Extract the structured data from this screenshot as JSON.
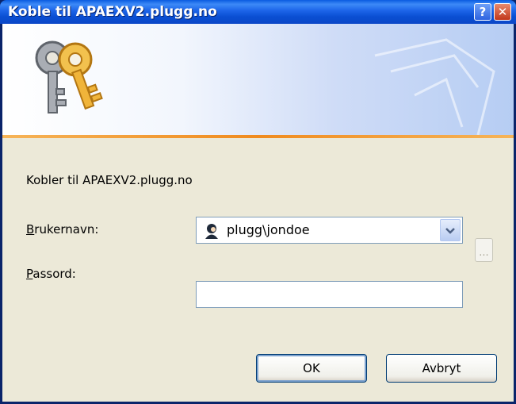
{
  "window": {
    "title": "Koble til APAEXV2.plugg.no"
  },
  "titlebar": {
    "help_label": "?",
    "close_label": "✕"
  },
  "dialog": {
    "connecting_text": "Kobler til APAEXV2.plugg.no",
    "username_label_mnemonic": "B",
    "username_label_rest": "rukernavn:",
    "username_value": "plugg\\jondoe",
    "password_label_mnemonic": "P",
    "password_label_rest": "assord:",
    "password_value": "",
    "browse_label": "..."
  },
  "buttons": {
    "ok": "OK",
    "cancel": "Avbryt"
  },
  "colors": {
    "titlebar": "#0A5BE0",
    "banner_strip": "#F08B1F",
    "dialog_bg": "#ECE9D8"
  },
  "icons": [
    "keys-icon",
    "user-icon",
    "dropdown-arrow-icon",
    "help-icon",
    "close-icon"
  ]
}
